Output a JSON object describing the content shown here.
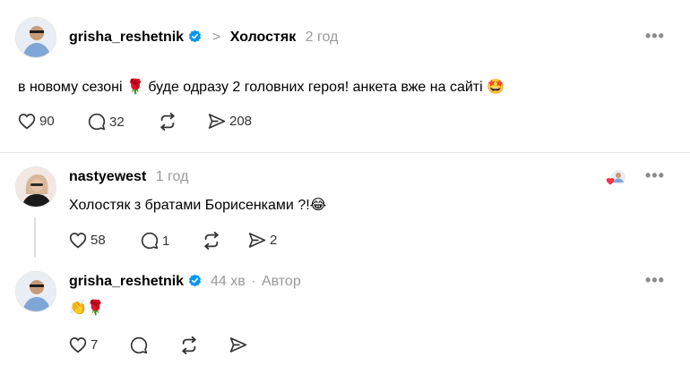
{
  "post": {
    "username": "grisha_reshetnik",
    "separator": ">",
    "community": "Холостяк",
    "time": "2 год",
    "text": "в новому сезоні 🌹 буде одразу 2 головних героя! анкета вже на сайті 🤩",
    "likes": "90",
    "comments": "32",
    "shares": "208"
  },
  "reply1": {
    "username": "nastyewest",
    "time": "1 год",
    "text": "Холостяк з братами Борисенками ?!😂",
    "likes": "58",
    "comments": "1",
    "shares": "2"
  },
  "reply2": {
    "username": "grisha_reshetnik",
    "time": "44 хв",
    "dot": "·",
    "role": "Автор",
    "text": "👏🌹",
    "likes": "7"
  },
  "icons": {
    "verified": "verified-badge-icon",
    "like": "heart-icon",
    "comment": "comment-bubble-icon",
    "repost": "repost-icon",
    "share": "send-icon",
    "more": "more-icon",
    "liked_by": "liked-by-author-icon"
  },
  "colors": {
    "verified": "#0095f6",
    "muted": "#999999",
    "liked_heart": "#ff3040"
  }
}
